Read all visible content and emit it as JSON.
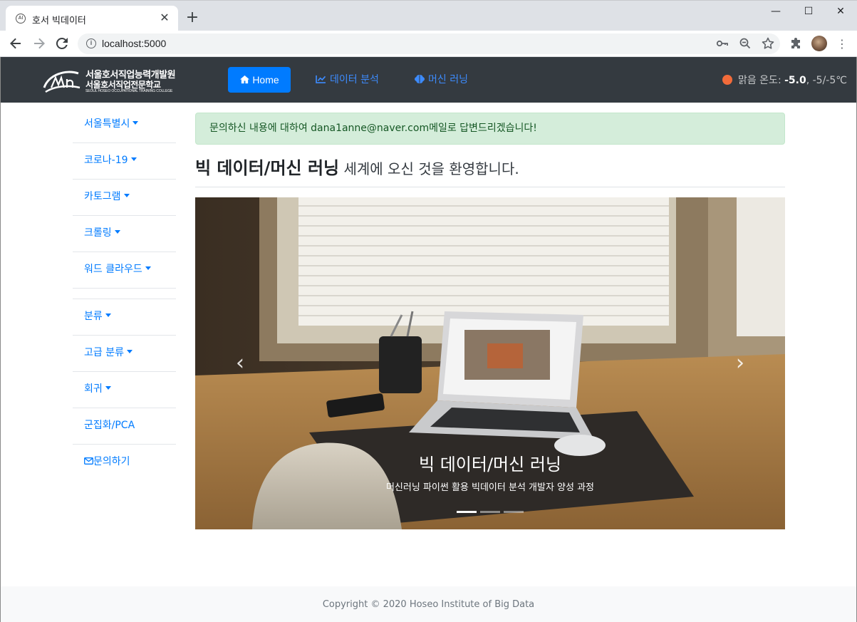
{
  "browser": {
    "tab_title": "호서 빅데이터",
    "favicon_text": "AI",
    "close_glyph": "✕",
    "new_tab_glyph": "+",
    "url": "localhost:5000",
    "win_minimize": "—",
    "win_maximize": "☐",
    "win_close": "✕"
  },
  "navbar": {
    "brand_line1": "서울호서직업능력개발원",
    "brand_line2": "서울호서직업전문학교",
    "brand_line3": "SEOUL HOSEO OCCUPATIONAL TRAINING COLLEGE",
    "home_label": "Home",
    "analysis_label": "데이터 분석",
    "ml_label": "머신 러닝",
    "weather": {
      "prefix": "맑음 온도: ",
      "temp": "-5.0",
      "range": ", -5/-5℃",
      "dot_color": "#f26b3a"
    }
  },
  "sidebar": {
    "items": [
      {
        "label": "서울특별시",
        "dropdown": true
      },
      {
        "label": "코로나-19",
        "dropdown": true
      },
      {
        "label": "카토그램",
        "dropdown": true
      },
      {
        "label": "크롤링",
        "dropdown": true
      },
      {
        "label": "워드 클라우드",
        "dropdown": true
      },
      {
        "label": "분류",
        "dropdown": true
      },
      {
        "label": "고급 분류",
        "dropdown": true
      },
      {
        "label": "회귀",
        "dropdown": true
      },
      {
        "label": "군집화/PCA",
        "dropdown": false
      },
      {
        "label": "문의하기",
        "dropdown": false
      }
    ]
  },
  "main": {
    "alert": "문의하신 내용에 대하여 dana1anne@naver.com메일로 답변드리겠습니다!",
    "welcome_bold": "빅 데이터/머신 러닝",
    "welcome_rest": " 세계에 오신 것을 환영합니다.",
    "carousel": {
      "caption_title": "빅 데이터/머신 러닝",
      "caption_sub": "머신러닝 파이썬 활용 빅데이터 분석 개발자 양성 과정",
      "prev_glyph": "‹",
      "next_glyph": "›",
      "slide_count": 3,
      "active_slide": 1
    }
  },
  "footer": {
    "text": "Copyright © 2020 Hoseo Institute of Big Data"
  },
  "colors": {
    "navbar_bg": "#343a40",
    "primary": "#007bff",
    "alert_bg": "#d4edda",
    "alert_text": "#155724"
  }
}
